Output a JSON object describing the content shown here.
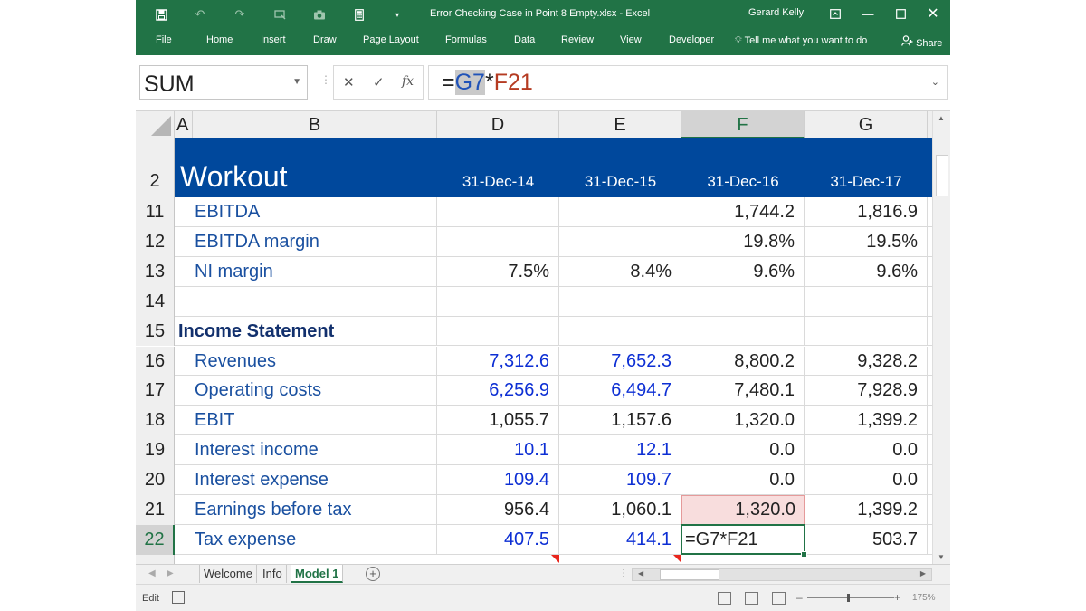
{
  "window": {
    "title": "Error Checking Case in Point 8 Empty.xlsx  -  Excel",
    "user": "Gerard Kelly"
  },
  "ribbon_tabs": [
    "File",
    "Home",
    "Insert",
    "Draw",
    "Page Layout",
    "Formulas",
    "Data",
    "Review",
    "View",
    "Developer"
  ],
  "tell_me": "Tell me what you want to do",
  "share": "Share",
  "name_box": "SUM",
  "formula": {
    "prefix": "=",
    "ref1": "G7",
    "op": "*",
    "ref2": "F21"
  },
  "columns": [
    "A",
    "B",
    "D",
    "E",
    "F",
    "G"
  ],
  "header": {
    "row_number": "2",
    "title": "Workout",
    "dates": [
      "31-Dec-14",
      "31-Dec-15",
      "31-Dec-16",
      "31-Dec-17"
    ]
  },
  "rows": [
    {
      "num": "11",
      "label": "EBITDA",
      "d": "",
      "e": "",
      "f": "1,744.2",
      "g": "1,816.9"
    },
    {
      "num": "12",
      "label": "EBITDA margin",
      "d": "",
      "e": "",
      "f": "19.8%",
      "g": "19.5%"
    },
    {
      "num": "13",
      "label": "NI margin",
      "d": "7.5%",
      "e": "8.4%",
      "f": "9.6%",
      "g": "9.6%"
    },
    {
      "num": "14",
      "label": "",
      "d": "",
      "e": "",
      "f": "",
      "g": ""
    },
    {
      "num": "15",
      "label": "Income Statement",
      "d": "",
      "e": "",
      "f": "",
      "g": ""
    },
    {
      "num": "16",
      "label": "Revenues",
      "d": "7,312.6",
      "e": "7,652.3",
      "f": "8,800.2",
      "g": "9,328.2"
    },
    {
      "num": "17",
      "label": "Operating costs",
      "d": "6,256.9",
      "e": "6,494.7",
      "f": "7,480.1",
      "g": "7,928.9"
    },
    {
      "num": "18",
      "label": "EBIT",
      "d": "1,055.7",
      "e": "1,157.6",
      "f": "1,320.0",
      "g": "1,399.2"
    },
    {
      "num": "19",
      "label": "Interest income",
      "d": "10.1",
      "e": "12.1",
      "f": "0.0",
      "g": "0.0"
    },
    {
      "num": "20",
      "label": "Interest expense",
      "d": "109.4",
      "e": "109.7",
      "f": "0.0",
      "g": "0.0"
    },
    {
      "num": "21",
      "label": "Earnings before tax",
      "d": "956.4",
      "e": "1,060.1",
      "f": "1,320.0",
      "g": "1,399.2"
    },
    {
      "num": "22",
      "label": "Tax expense",
      "d": "407.5",
      "e": "414.1",
      "f": "=G7*F21",
      "g": "503.7"
    }
  ],
  "sheet_tabs": [
    "Welcome",
    "Info",
    "Model 1"
  ],
  "active_sheet": "Model 1",
  "status": {
    "mode": "Edit",
    "zoom": "175%"
  }
}
